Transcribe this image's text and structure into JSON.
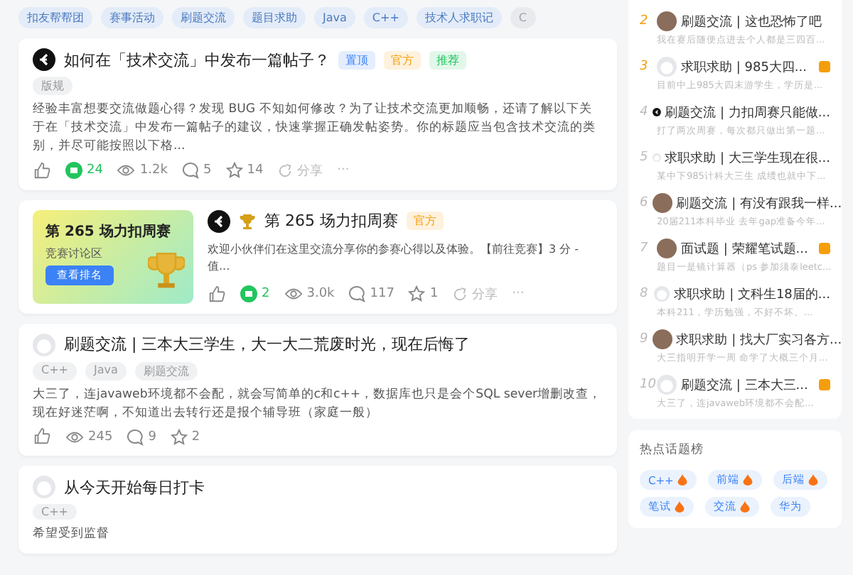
{
  "filter_tags": [
    "扣友帮帮团",
    "赛事活动",
    "刷题交流",
    "题目求助",
    "Java",
    "C++",
    "技术人求职记",
    "C"
  ],
  "posts": [
    {
      "kind": "normal",
      "avatar": {
        "kind": "logo"
      },
      "trophy": false,
      "title": "如何在「技术交流」中发布一篇帖子？",
      "badges": [
        {
          "label": "置顶",
          "color": "#3b82f6"
        },
        {
          "label": "官方",
          "color": "#f59e0b"
        },
        {
          "label": "推荐",
          "color": "#22c55e"
        }
      ],
      "tags": [
        "版规"
      ],
      "excerpt": "经验丰富想要交流做题心得？发现 BUG 不知如何修改？为了让技术交流更加顺畅，还请了解以下关于在「技术交流」中发布一篇帖子的建议，快速掌握正确发帖姿势。你的标题应当包含技术交流的类别，并尽可能按照以下格...",
      "stats": {
        "reactions": "24",
        "views": "1.2k",
        "comments": "5",
        "stars": "14",
        "share": "分享",
        "more": "···"
      }
    },
    {
      "kind": "banner",
      "avatar": {
        "kind": "logo"
      },
      "trophy": true,
      "title": "第 265 场力扣周赛",
      "badges": [
        {
          "label": "官方",
          "color": "#f59e0b"
        }
      ],
      "banner": {
        "title": "第 265 场力扣周赛",
        "subtitle": "竞赛讨论区",
        "button": "查看排名"
      },
      "excerpt": "欢迎小伙伴们在这里交流分享你的参赛心得以及体验。【前往竞赛】3 分 - 值...",
      "stats": {
        "reactions": "2",
        "views": "3.0k",
        "comments": "117",
        "stars": "1",
        "share": "分享",
        "more": "···"
      }
    },
    {
      "kind": "normal",
      "avatar": {
        "kind": "blank"
      },
      "trophy": false,
      "title": "刷题交流 | 三本大三学生，大一大二荒废时光，现在后悔了",
      "tags": [
        "C++",
        "Java",
        "刷题交流"
      ],
      "excerpt": "大三了，连javaweb环境都不会配，就会写简单的c和c++，数据库也只是会个SQL sever增删改查，现在好迷茫啊，不知道出去转行还是报个辅导班（家庭一般）",
      "stats": {
        "views": "245",
        "comments": "9",
        "stars": "2"
      }
    },
    {
      "kind": "normal",
      "avatar": {
        "kind": "blank"
      },
      "trophy": false,
      "title": "从今天开始每日打卡",
      "tags": [
        "C++"
      ],
      "excerpt": "希望受到监督"
    }
  ],
  "ranking": [
    {
      "rank": "2",
      "top": true,
      "avatar": {
        "kind": "photo"
      },
      "title": "刷题交流 | 这也恐怖了吧",
      "summary": "我在赛后随便点进去个人都是三四百...",
      "new": false
    },
    {
      "rank": "3",
      "top": true,
      "avatar": {
        "kind": "blank"
      },
      "title": "求职求助 | 985大四...",
      "summary": "目前中上985大四末游学生，学历是...",
      "new": true
    },
    {
      "rank": "4",
      "top": false,
      "avatar": {
        "kind": "logo"
      },
      "title": "刷题交流 | 力扣周赛只能做...",
      "summary": "打了两次周赛，每次都只做出第一题...",
      "new": false
    },
    {
      "rank": "5",
      "top": false,
      "avatar": {
        "kind": "blank"
      },
      "title": "求职求助 | 大三学生现在很...",
      "summary": "某中下985计科大三生 成绩也就中下...",
      "new": false
    },
    {
      "rank": "6",
      "top": false,
      "avatar": {
        "kind": "photo"
      },
      "title": "刷题交流 | 有没有跟我一样...",
      "summary": "20届211本科毕业 去年gap准备今年...",
      "new": false
    },
    {
      "rank": "7",
      "top": false,
      "avatar": {
        "kind": "photo"
      },
      "title": "面试题 | 荣耀笔试题...",
      "summary": "题目一是镜计算器（ps 参加须泰leetc...",
      "new": true
    },
    {
      "rank": "8",
      "top": false,
      "avatar": {
        "kind": "blank"
      },
      "title": "求职求助 | 文科生18届的...",
      "summary": "本科211，学历勉强，不好不坏。...",
      "new": false
    },
    {
      "rank": "9",
      "top": false,
      "avatar": {
        "kind": "photo"
      },
      "title": "求职求助 | 找大厂实习各方...",
      "summary": "大三指明开学一周 命学了大概三个月...",
      "new": false
    },
    {
      "rank": "10",
      "top": false,
      "avatar": {
        "kind": "blank"
      },
      "title": "刷题交流 | 三本大三...",
      "summary": "大三了，连javaweb环境都不会配...",
      "new": true
    }
  ],
  "hot_topics": {
    "title": "热点话题榜",
    "tags": [
      {
        "label": "C++",
        "hot": true
      },
      {
        "label": "前端",
        "hot": true
      },
      {
        "label": "后端",
        "hot": true
      },
      {
        "label": "笔试",
        "hot": true
      },
      {
        "label": "交流",
        "hot": true
      },
      {
        "label": "华为",
        "hot": false
      }
    ]
  }
}
